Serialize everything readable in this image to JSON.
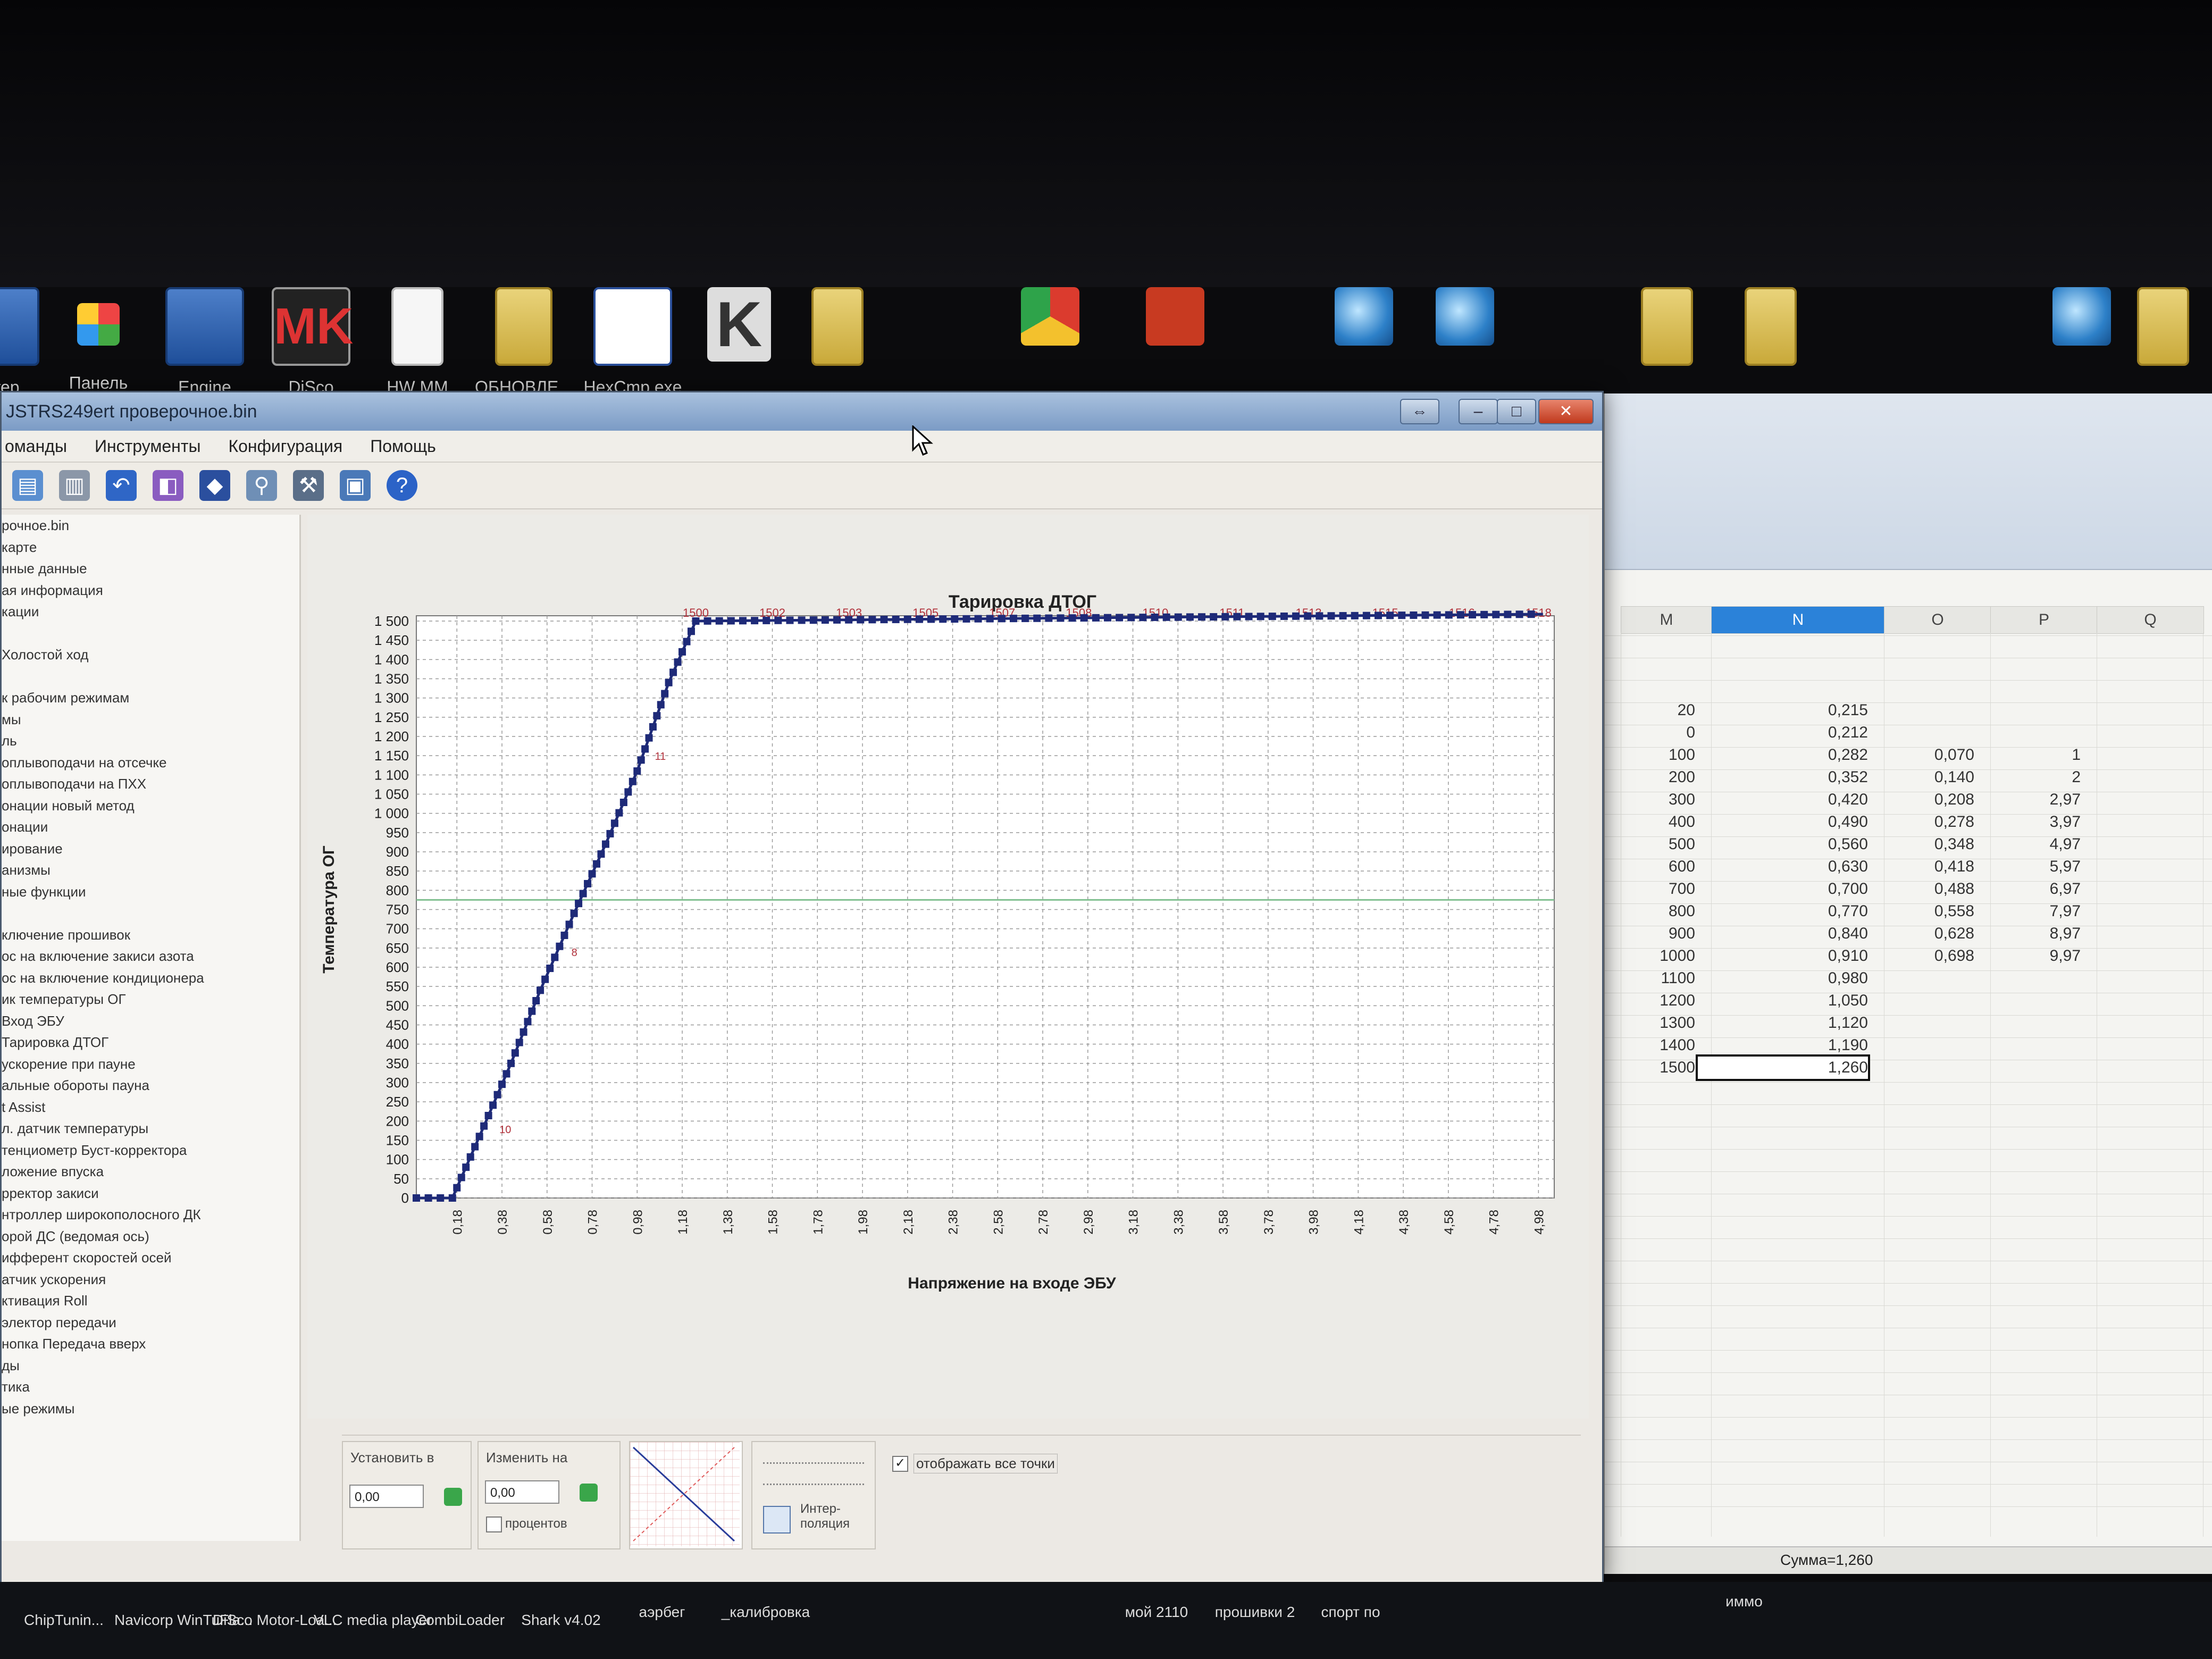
{
  "desktop": {
    "icons": [
      {
        "label": "ютер",
        "icon": "computer-icon"
      },
      {
        "label": "Панель",
        "icon": "control-panel-icon"
      },
      {
        "label": "Engine",
        "icon": "engine-app-icon"
      },
      {
        "label": "DiSco",
        "icon": "disco-app-icon"
      },
      {
        "label": "HW MM",
        "icon": "file-icon"
      },
      {
        "label": "ОБНОВЛЕ...",
        "icon": "folder-icon"
      },
      {
        "label": "HexCmp.exe",
        "icon": "hexcmp-icon"
      }
    ],
    "taskbar": [
      "ChipTunin...",
      "Navicorp WinTuFla...",
      "DiSco Motor-Loa...",
      "VLC media player",
      "CombiLoader",
      "Shark v4.02",
      "аэрбег",
      "_калибровка",
      "мой 2110",
      "прошивки 2",
      "спорт по",
      "иммо"
    ]
  },
  "app": {
    "window_title": "JSTRS249ert проверочное.bin",
    "menu": [
      "оманды",
      "Инструменты",
      "Конфигурация",
      "Помощь"
    ],
    "tree_items": [
      "рочное.bin",
      "карте",
      "нные данные",
      "ая информация",
      "кации",
      "",
      "Холостой ход",
      "",
      "к рабочим режимам",
      "мы",
      "ль",
      "оплывоподачи на отсечке",
      "оплывоподачи на ПХХ",
      "онации новый метод",
      "онации",
      "ирование",
      "анизмы",
      "ные функции",
      "",
      "ключение прошивок",
      "ос на включение закиси азота",
      "ос на включение кондиционера",
      "ик температуры ОГ",
      "Вход ЭБУ",
      "Тарировка ДТОГ",
      "ускорение при пауне",
      "альные обороты пауна",
      "t Assist",
      "л. датчик температуры",
      "тенциометр Буст-корректора",
      "ложение впуска",
      "рректор закиси",
      "нтроллер широкополосного ДК",
      "орой ДС (ведомая ось)",
      "ифферент скоростей осей",
      "атчик ускорения",
      "ктивация Roll",
      "электор передачи",
      "нопка Передача вверх",
      "ды",
      "тика",
      "ые режимы"
    ],
    "controls": {
      "set_label": "Установить в",
      "set_value": "0,00",
      "change_label": "Изменить на",
      "change_value": "0,00",
      "percent_label": "процентов",
      "interp_label": "Интер-\nполяция",
      "show_all_label": "отображать все точки",
      "show_all_checked": true
    }
  },
  "chart_data": {
    "type": "scatter",
    "title": "Тарировка ДТОГ",
    "xlabel": "Напряжение на входе ЭБУ",
    "ylabel": "Температура ОГ",
    "xlim": [
      0.0,
      5.0
    ],
    "ylim": [
      0,
      1500
    ],
    "x_ticks": [
      "0,18",
      "0,38",
      "0,58",
      "0,78",
      "0,98",
      "1,18",
      "1,38",
      "1,58",
      "1,78",
      "1,98",
      "2,18",
      "2,38",
      "2,58",
      "2,78",
      "2,98",
      "3,18",
      "3,38",
      "3,58",
      "3,78",
      "3,98",
      "4,18",
      "4,38",
      "4,58",
      "4,78",
      "4,98"
    ],
    "y_ticks": [
      "0",
      "50",
      "100",
      "150",
      "200",
      "250",
      "300",
      "350",
      "400",
      "450",
      "500",
      "550",
      "600",
      "650",
      "700",
      "750",
      "800",
      "850",
      "900",
      "950",
      "1 000",
      "1 050",
      "1 100",
      "1 150",
      "1 200",
      "1 250",
      "1 300",
      "1 350",
      "1 400",
      "1 450",
      "1 500"
    ],
    "top_labels": [
      "1500",
      "1502",
      "1503",
      "1505",
      "1507",
      "1508",
      "1510",
      "1511",
      "1513",
      "1515",
      "1516",
      "1518"
    ],
    "inline_labels": [
      "10",
      "8",
      "11"
    ],
    "series": [
      {
        "points": [
          [
            0.0,
            0
          ],
          [
            0.16,
            0
          ],
          [
            0.28,
            160
          ],
          [
            0.42,
            350
          ],
          [
            0.55,
            540
          ],
          [
            0.7,
            740
          ],
          [
            0.84,
            920
          ],
          [
            0.98,
            1110
          ],
          [
            1.12,
            1340
          ],
          [
            1.24,
            1500
          ],
          [
            5.0,
            1518
          ]
        ],
        "color": "#1e2a78"
      }
    ],
    "ref_line_y": 775
  },
  "sheet": {
    "columns": [
      "M",
      "N",
      "O",
      "P",
      "Q"
    ],
    "selected_column": "N",
    "rows": [
      [
        "20",
        "0,215",
        "",
        ""
      ],
      [
        "0",
        "0,212",
        "",
        ""
      ],
      [
        "100",
        "0,282",
        "0,070",
        "1"
      ],
      [
        "200",
        "0,352",
        "0,140",
        "2"
      ],
      [
        "300",
        "0,420",
        "0,208",
        "2,97"
      ],
      [
        "400",
        "0,490",
        "0,278",
        "3,97"
      ],
      [
        "500",
        "0,560",
        "0,348",
        "4,97"
      ],
      [
        "600",
        "0,630",
        "0,418",
        "5,97"
      ],
      [
        "700",
        "0,700",
        "0,488",
        "6,97"
      ],
      [
        "800",
        "0,770",
        "0,558",
        "7,97"
      ],
      [
        "900",
        "0,840",
        "0,628",
        "8,97"
      ],
      [
        "1000",
        "0,910",
        "0,698",
        "9,97"
      ],
      [
        "1100",
        "0,980",
        "",
        ""
      ],
      [
        "1200",
        "1,050",
        "",
        ""
      ],
      [
        "1300",
        "1,120",
        "",
        ""
      ],
      [
        "1400",
        "1,190",
        "",
        ""
      ],
      [
        "1500",
        "1,260",
        "",
        ""
      ]
    ],
    "status": "Сумма=1,260"
  }
}
